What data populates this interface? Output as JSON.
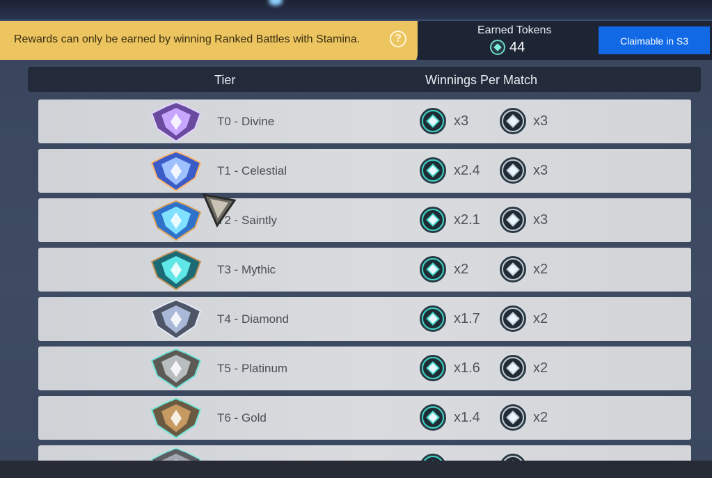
{
  "info_banner": {
    "message": "Rewards can only be earned by winning Ranked Battles with Stamina.",
    "help_icon": "question-icon"
  },
  "tokens": {
    "label": "Earned Tokens",
    "count": "44"
  },
  "claim_button": {
    "label": "Claimable in S3"
  },
  "table": {
    "header_tier": "Tier",
    "header_winnings": "Winnings Per Match",
    "rows": [
      {
        "tier": "T0 - Divine",
        "token_a": "x3",
        "token_b": "x3"
      },
      {
        "tier": "T1 - Celestial",
        "token_a": "x2.4",
        "token_b": "x3"
      },
      {
        "tier": "T2 - Saintly",
        "token_a": "x2.1",
        "token_b": "x3"
      },
      {
        "tier": "T3 - Mythic",
        "token_a": "x2",
        "token_b": "x2"
      },
      {
        "tier": "T4 - Diamond",
        "token_a": "x1.7",
        "token_b": "x2"
      },
      {
        "tier": "T5 - Platinum",
        "token_a": "x1.6",
        "token_b": "x2"
      },
      {
        "tier": "T6 - Gold",
        "token_a": "x1.4",
        "token_b": "x2"
      }
    ]
  },
  "colors": {
    "accent_blue": "#1169e6",
    "banner_gold": "#ecc560",
    "token_teal": "#3fd6c6"
  }
}
